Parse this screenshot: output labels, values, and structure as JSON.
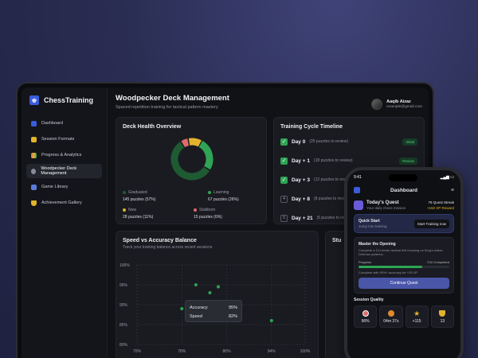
{
  "app": {
    "name": "ChessTraining"
  },
  "sidebar": {
    "items": [
      {
        "label": "Dashboard",
        "color": "#3b5bd9"
      },
      {
        "label": "Session Formats",
        "color": "#e2b32c"
      },
      {
        "label": "Progress & Analytics",
        "color": "#e08a2c"
      },
      {
        "label": "Woodpecker Deck Management",
        "color": "#888a99"
      },
      {
        "label": "Game Library",
        "color": "#5c7bdc"
      },
      {
        "label": "Achievement Gallery",
        "color": "#e2b32c"
      }
    ]
  },
  "header": {
    "title": "Woodpecker Deck Management",
    "subtitle": "Spaced repetition training for tactical pattern mastery",
    "user_name": "Aaqib Aizaz",
    "user_email": "example@gmail.com"
  },
  "deck_health": {
    "title": "Deck Health Overview",
    "segments": [
      {
        "label": "Graduated",
        "value": "145 puzzles (57%)",
        "percent": 57,
        "color": "#1e5a32"
      },
      {
        "label": "Learning",
        "value": "67 puzzles (26%)",
        "percent": 26,
        "color": "#2fa455"
      },
      {
        "label": "New",
        "value": "28 puzzles (11%)",
        "percent": 11,
        "color": "#e2b32c"
      },
      {
        "label": "Stubborn",
        "value": "15 puzzles (6%)",
        "percent": 6,
        "color": "#e06b6b"
      }
    ]
  },
  "timeline": {
    "title": "Training Cycle Timeline",
    "rows": [
      {
        "day": "Day 0",
        "desc": "(25 puzzles to review)",
        "tag": "Initial",
        "done": true
      },
      {
        "day": "Day + 1",
        "desc": "(18 puzzles to review)",
        "tag": "Review",
        "done": true
      },
      {
        "day": "Day + 3",
        "desc": "(12 puzzles to review)",
        "tag": "",
        "done": true
      },
      {
        "day": "Day + 8",
        "desc": "(8 puzzles to review)",
        "tag": "",
        "done": false,
        "num": "4"
      },
      {
        "day": "Day + 21",
        "desc": "(5 puzzles to review)",
        "tag": "",
        "done": false,
        "num": "5"
      }
    ]
  },
  "speed_card": {
    "title": "Speed vs Accuracy Balance",
    "subtitle": "Track your training balance across recent sessions",
    "tooltip": {
      "accuracy_label": "Accuracy",
      "accuracy_value": "95%",
      "speed_label": "Speed",
      "speed_value": "82%"
    }
  },
  "chart_data": {
    "type": "scatter",
    "x_ticks": [
      "70%",
      "78%",
      "86%",
      "94%",
      "100%"
    ],
    "y_ticks": [
      "100%",
      "95%",
      "90%",
      "85%",
      "80%"
    ],
    "xlim": [
      70,
      100
    ],
    "ylim": [
      80,
      100
    ],
    "points": [
      {
        "x": 78,
        "y": 89
      },
      {
        "x": 80.5,
        "y": 95
      },
      {
        "x": 83,
        "y": 93
      },
      {
        "x": 84.5,
        "y": 94.5
      },
      {
        "x": 94,
        "y": 86
      }
    ],
    "point_color": "#2fa455",
    "grid": true
  },
  "partial_card": {
    "title": "Stu"
  },
  "phone": {
    "time": "9:41",
    "title": "Dashboard",
    "quest_title": "Today's Quest",
    "quest_sub": "Your daily chess mission",
    "streak": "79 Quest Streak",
    "xp": "+150 XP Reward",
    "quick_start_title": "Quick Start",
    "quick_start_sub": "Jump into training",
    "start_button": "Start Training now",
    "master_title": "Master the Opening",
    "master_desc": "Complete a 10-minute tactical drill focusing on King's Indian Defense patterns.",
    "progress_label": "Progress",
    "progress_value": "7/10 Completed",
    "progress_fraction": 0.7,
    "note": "Complete with 90%+ accuracy for +25 XP",
    "continue_button": "Continue Quest",
    "session_quality": "Session Quality",
    "stats": [
      {
        "value": "96%",
        "icon": "target-icon",
        "color": "#e06b6b"
      },
      {
        "value": "04m 37s",
        "icon": "timer-icon",
        "color": "#e08a2c"
      },
      {
        "value": "+115",
        "icon": "star-icon",
        "color": "#e2b32c"
      },
      {
        "value": "13",
        "icon": "trophy-icon",
        "color": "#e2b32c"
      }
    ]
  }
}
